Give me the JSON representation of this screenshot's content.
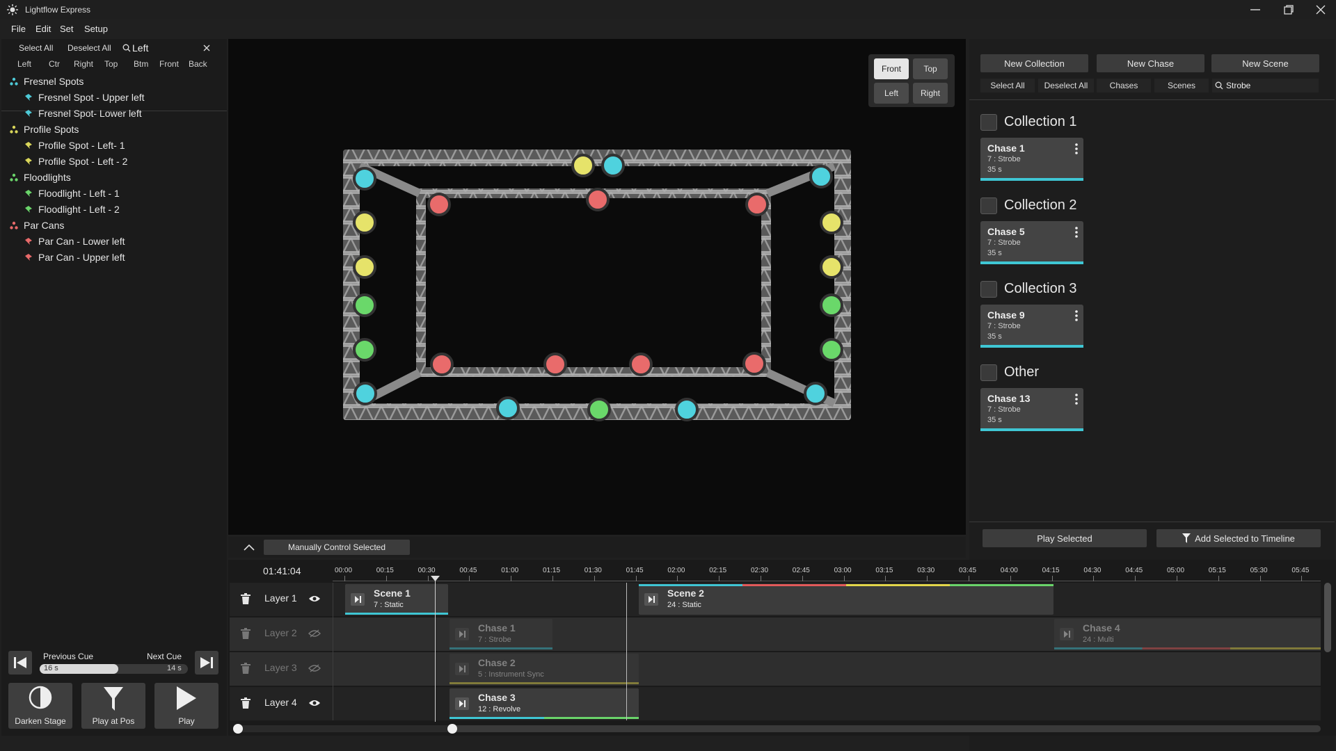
{
  "app": {
    "title": "Lightflow Express"
  },
  "menu": [
    "File",
    "Edit",
    "Set",
    "Setup"
  ],
  "left_panel": {
    "select_all": "Select All",
    "deselect_all": "Deselect All",
    "search_value": "Left",
    "view_tabs": [
      "Left",
      "Ctr",
      "Right",
      "Top",
      "Btm",
      "Front",
      "Back"
    ],
    "groups": [
      {
        "label": "Fresnel Spots",
        "color": "#4ec9d6",
        "items": [
          "Fresnel Spot - Upper left",
          "Fresnel Spot- Lower left"
        ]
      },
      {
        "label": "Profile Spots",
        "color": "#d9d65a",
        "items": [
          "Profile Spot - Left- 1",
          "Profile Spot - Left - 2"
        ]
      },
      {
        "label": "Floodlights",
        "color": "#6ad46a",
        "items": [
          "Floodlight - Left - 1",
          "Floodlight - Left - 2"
        ]
      },
      {
        "label": "Par Cans",
        "color": "#e86a6a",
        "items": [
          "Par Can - Lower left",
          "Par Can - Upper left"
        ]
      }
    ]
  },
  "viewport": {
    "view_buttons": [
      "Front",
      "Top",
      "Left",
      "Right"
    ],
    "active_view": "Front"
  },
  "right_panel": {
    "new_collection": "New Collection",
    "new_chase": "New Chase",
    "new_scene": "New Scene",
    "select_all": "Select All",
    "deselect_all": "Deselect All",
    "filter_chases": "Chases",
    "filter_scenes": "Scenes",
    "search_value": "Strobe",
    "collections": [
      {
        "title": "Collection 1",
        "card": {
          "name": "Chase 1",
          "sub": "7 : Strobe",
          "dur": "35 s"
        }
      },
      {
        "title": "Collection 2",
        "card": {
          "name": "Chase 5",
          "sub": "7 : Strobe",
          "dur": "35 s"
        }
      },
      {
        "title": "Collection 3",
        "card": {
          "name": "Chase 9",
          "sub": "7 : Strobe",
          "dur": "35 s"
        }
      },
      {
        "title": "Other",
        "card": {
          "name": "Chase 13",
          "sub": "7 : Strobe",
          "dur": "35 s"
        }
      }
    ],
    "play_selected": "Play Selected",
    "add_to_timeline": "Add Selected to Timeline"
  },
  "manual": {
    "label": "Manually Control Selected"
  },
  "timeline": {
    "time": "01:41:04",
    "ticks": [
      "00:00",
      "00:15",
      "00:30",
      "00:45",
      "01:00",
      "01:15",
      "01:30",
      "01:45",
      "02:00",
      "02:15",
      "02:30",
      "02:45",
      "03:00",
      "03:15",
      "03:30",
      "03:45",
      "04:00",
      "04:15",
      "04:30",
      "04:45",
      "05:00",
      "05:15",
      "05:30",
      "05:45"
    ],
    "layers": [
      {
        "name": "Layer 1",
        "visible": true
      },
      {
        "name": "Layer 2",
        "visible": false
      },
      {
        "name": "Layer 3",
        "visible": false
      },
      {
        "name": "Layer 4",
        "visible": true
      }
    ],
    "clips": {
      "scene1": {
        "name": "Scene 1",
        "sub": "7 : Static"
      },
      "scene2": {
        "name": "Scene 2",
        "sub": "24 : Static"
      },
      "chase1": {
        "name": "Chase 1",
        "sub": "7 : Strobe"
      },
      "chase4": {
        "name": "Chase 4",
        "sub": "24 : Multi"
      },
      "chase2": {
        "name": "Chase 2",
        "sub": "5 : Instrument Sync"
      },
      "chase3": {
        "name": "Chase 3",
        "sub": "12 : Revolve"
      }
    }
  },
  "transport": {
    "previous_cue": "Previous Cue",
    "next_cue": "Next Cue",
    "prev_time": "16 s",
    "next_time": "14 s",
    "progress": 0.53,
    "darken": "Darken Stage",
    "play_at_pos": "Play at Pos",
    "play": "Play"
  }
}
